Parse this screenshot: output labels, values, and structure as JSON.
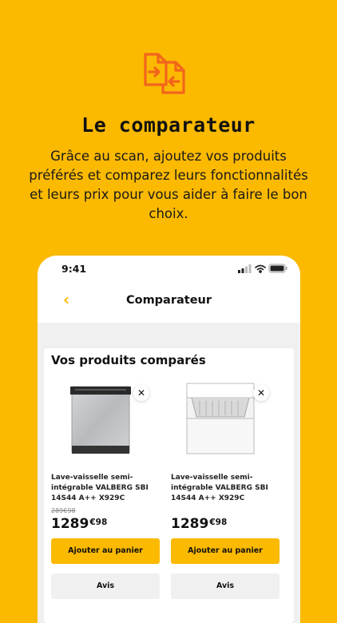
{
  "hero": {
    "icon": "compare-documents-icon",
    "title": "Le comparateur",
    "description": "Grâce au scan, ajoutez vos produits préférés et comparez leurs fonctionnalités et leurs prix pour vous aider à faire le bon choix."
  },
  "status_bar": {
    "time": "9:41"
  },
  "header": {
    "back_icon": "chevron-left-icon",
    "title": "Comparateur"
  },
  "section": {
    "title": "Vos produits comparés"
  },
  "products": [
    {
      "name": "Lave-vaisselle semi-intégrable VALBERG SBI 14S44 A++ X929C",
      "old_price": "289€98",
      "price_main": "1289",
      "price_cents": "€98",
      "add_to_cart": "Ajouter au panier",
      "reviews": "Avis"
    },
    {
      "name": "Lave-vaisselle semi-intégrable VALBERG SBI 14S44 A++ X929C",
      "old_price": "",
      "price_main": "1289",
      "price_cents": "€98",
      "add_to_cart": "Ajouter au panier",
      "reviews": "Avis"
    }
  ],
  "colors": {
    "brand_yellow": "#FBB900",
    "icon_orange": "#F2641C"
  }
}
